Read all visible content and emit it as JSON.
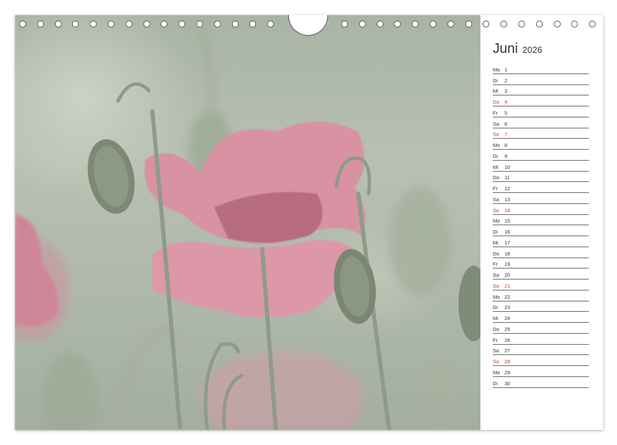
{
  "calendar": {
    "month": "Juni",
    "year": "2026",
    "sunday_color": "#c0392b",
    "days": [
      {
        "wd": "Mo",
        "d": "1"
      },
      {
        "wd": "Di",
        "d": "2"
      },
      {
        "wd": "Mi",
        "d": "3"
      },
      {
        "wd": "Do",
        "d": "4",
        "holiday": true
      },
      {
        "wd": "Fr",
        "d": "5"
      },
      {
        "wd": "Sa",
        "d": "6"
      },
      {
        "wd": "So",
        "d": "7",
        "holiday": true
      },
      {
        "wd": "Mo",
        "d": "8"
      },
      {
        "wd": "Di",
        "d": "9"
      },
      {
        "wd": "Mi",
        "d": "10"
      },
      {
        "wd": "Do",
        "d": "11"
      },
      {
        "wd": "Fr",
        "d": "12"
      },
      {
        "wd": "Sa",
        "d": "13"
      },
      {
        "wd": "So",
        "d": "14",
        "holiday": true
      },
      {
        "wd": "Mo",
        "d": "15"
      },
      {
        "wd": "Di",
        "d": "16"
      },
      {
        "wd": "Mi",
        "d": "17"
      },
      {
        "wd": "Do",
        "d": "18"
      },
      {
        "wd": "Fr",
        "d": "19"
      },
      {
        "wd": "Sa",
        "d": "20"
      },
      {
        "wd": "So",
        "d": "21",
        "holiday": true
      },
      {
        "wd": "Mo",
        "d": "22"
      },
      {
        "wd": "Di",
        "d": "23"
      },
      {
        "wd": "Mi",
        "d": "24"
      },
      {
        "wd": "Do",
        "d": "25"
      },
      {
        "wd": "Fr",
        "d": "26"
      },
      {
        "wd": "Sa",
        "d": "27"
      },
      {
        "wd": "So",
        "d": "28",
        "holiday": true
      },
      {
        "wd": "Mo",
        "d": "29"
      },
      {
        "wd": "Di",
        "d": "30"
      }
    ]
  },
  "photo": {
    "subject": "pink-poppy-photo",
    "colors": {
      "petal": "#d88ea0",
      "petal_dark": "#b86a80",
      "stem": "#8e9a86",
      "bud": "#7f8a76"
    }
  }
}
